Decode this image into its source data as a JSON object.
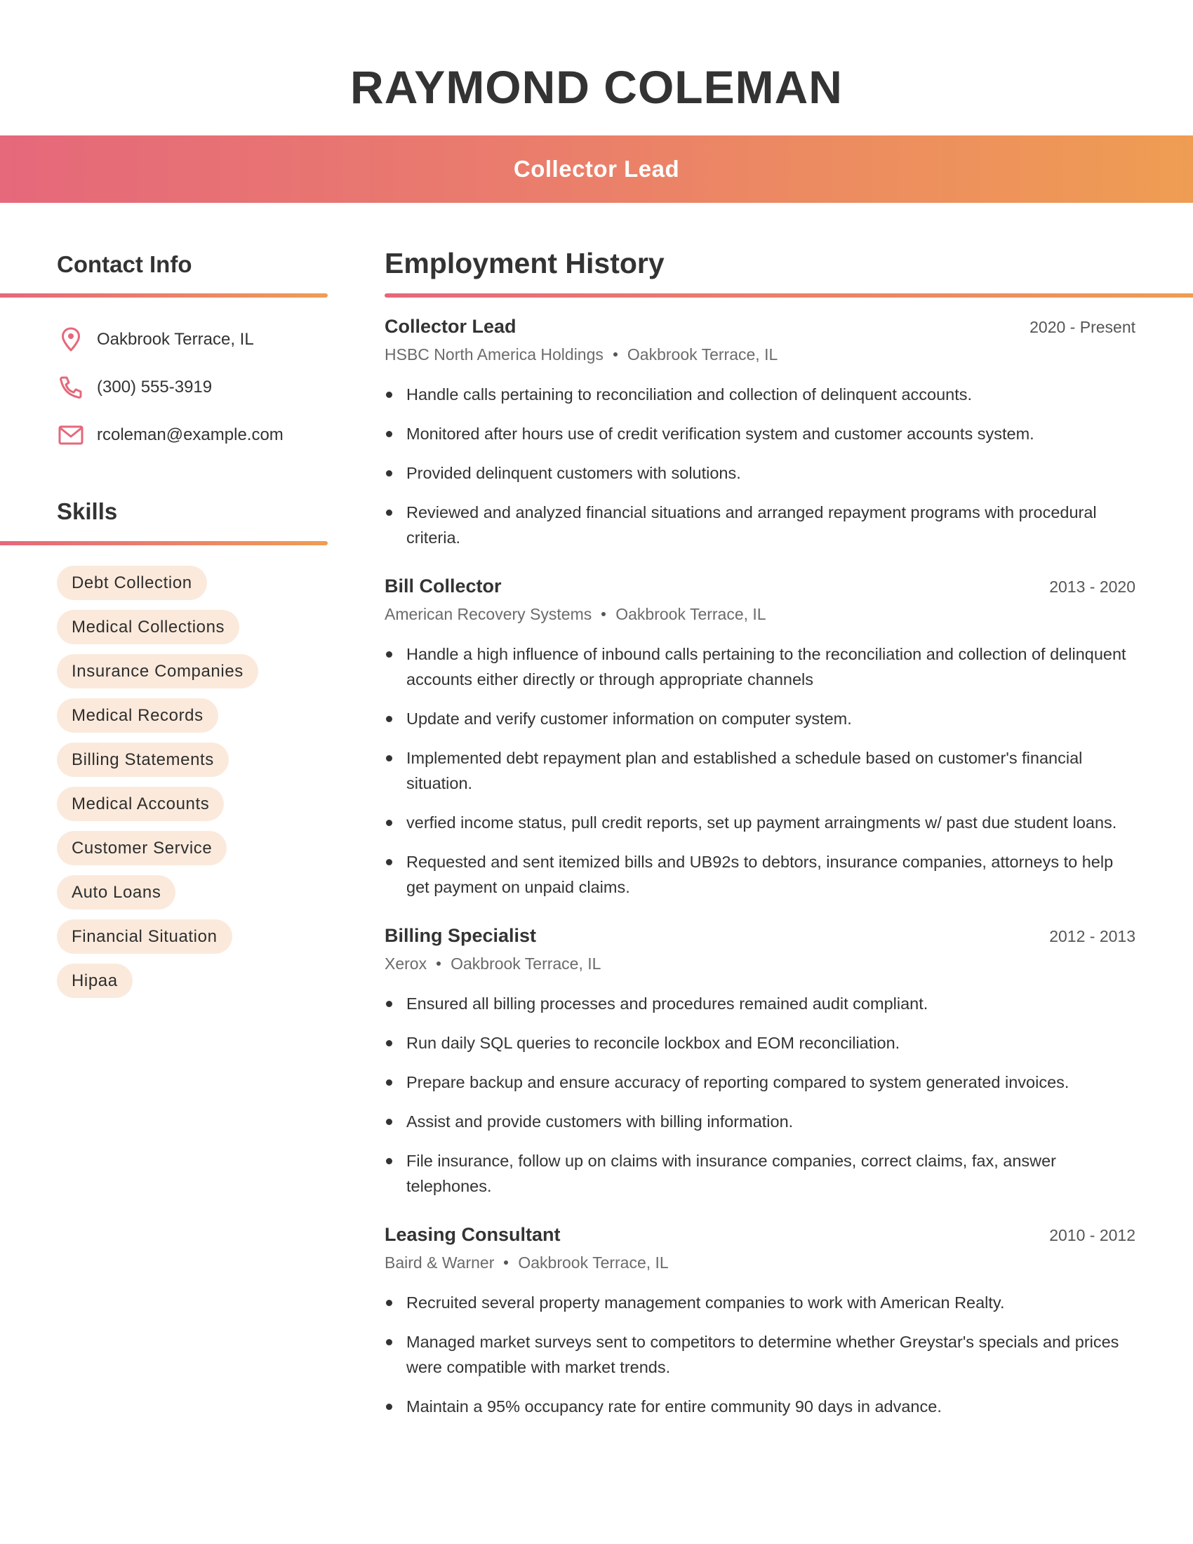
{
  "header": {
    "name": "RAYMOND COLEMAN",
    "title": "Collector Lead"
  },
  "colors": {
    "gradient_start": "#e5687b",
    "gradient_end": "#ef9d53",
    "pill_background": "#fbeadc",
    "icon_accent": "#e5687b",
    "text": "#333333"
  },
  "contact": {
    "heading": "Contact Info",
    "items": [
      {
        "icon": "location-pin-icon",
        "text": "Oakbrook Terrace, IL"
      },
      {
        "icon": "phone-icon",
        "text": "(300) 555-3919"
      },
      {
        "icon": "envelope-icon",
        "text": "rcoleman@example.com"
      }
    ]
  },
  "skills": {
    "heading": "Skills",
    "items": [
      "Debt Collection",
      "Medical Collections",
      "Insurance Companies",
      "Medical Records",
      "Billing Statements",
      "Medical Accounts",
      "Customer Service",
      "Auto Loans",
      "Financial Situation",
      "Hipaa"
    ]
  },
  "employment": {
    "heading": "Employment History",
    "jobs": [
      {
        "title": "Collector Lead",
        "dates": "2020 - Present",
        "company": "HSBC North America Holdings",
        "location": "Oakbrook Terrace, IL",
        "bullets": [
          "Handle calls pertaining to reconciliation and collection of delinquent accounts.",
          "Monitored after hours use of credit verification system and customer accounts system.",
          "Provided delinquent customers with solutions.",
          "Reviewed and analyzed financial situations and arranged repayment programs with procedural criteria."
        ]
      },
      {
        "title": "Bill Collector",
        "dates": "2013 - 2020",
        "company": "American Recovery Systems",
        "location": "Oakbrook Terrace, IL",
        "bullets": [
          "Handle a high influence of inbound calls pertaining to the reconciliation and collection of delinquent accounts either directly or through appropriate channels",
          "Update and verify customer information on computer system.",
          "Implemented debt repayment plan and established a schedule based on customer's financial situation.",
          "verfied income status, pull credit reports, set up payment arraingments w/ past due student loans.",
          "Requested and sent itemized bills and UB92s to debtors, insurance companies, attorneys to help get payment on unpaid claims."
        ]
      },
      {
        "title": "Billing Specialist",
        "dates": "2012 - 2013",
        "company": "Xerox",
        "location": "Oakbrook Terrace, IL",
        "bullets": [
          "Ensured all billing processes and procedures remained audit compliant.",
          "Run daily SQL queries to reconcile lockbox and EOM reconciliation.",
          "Prepare backup and ensure accuracy of reporting compared to system generated invoices.",
          "Assist and provide customers with billing information.",
          "File insurance, follow up on claims with insurance companies, correct claims, fax, answer telephones."
        ]
      },
      {
        "title": "Leasing Consultant",
        "dates": "2010 - 2012",
        "company": "Baird & Warner",
        "location": "Oakbrook Terrace, IL",
        "bullets": [
          "Recruited several property management companies to work with American Realty.",
          "Managed market surveys sent to competitors to determine whether Greystar's specials and prices were compatible with market trends.",
          "Maintain a 95% occupancy rate for entire community 90 days in advance."
        ]
      }
    ]
  }
}
